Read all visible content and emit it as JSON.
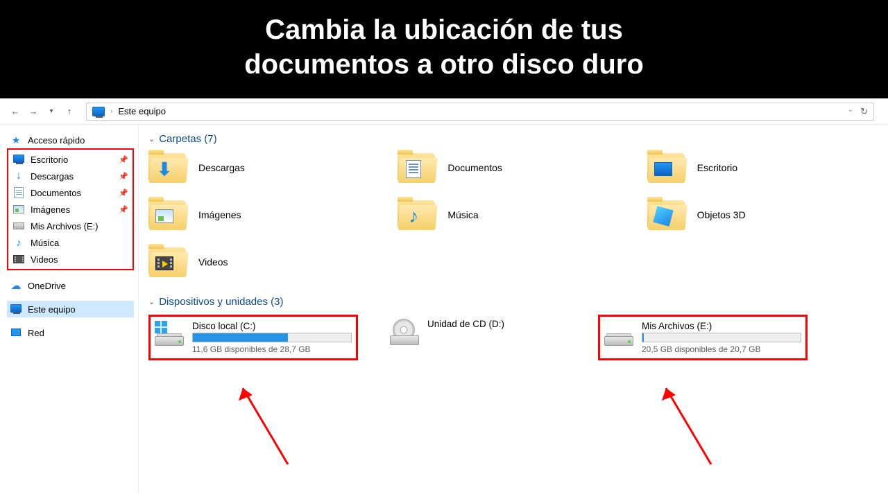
{
  "banner": {
    "line1": "Cambia la ubicación de tus",
    "line2": "documentos a otro disco duro"
  },
  "addressbar": {
    "location": "Este equipo"
  },
  "sidebar": {
    "quick_access": "Acceso rápido",
    "quick_items": [
      {
        "label": "Escritorio",
        "icon": "desktop",
        "pinned": true
      },
      {
        "label": "Descargas",
        "icon": "download",
        "pinned": true
      },
      {
        "label": "Documentos",
        "icon": "document",
        "pinned": true
      },
      {
        "label": "Imágenes",
        "icon": "image",
        "pinned": true
      },
      {
        "label": "Mis Archivos (E:)",
        "icon": "drive",
        "pinned": false
      },
      {
        "label": "Música",
        "icon": "music",
        "pinned": false
      },
      {
        "label": "Videos",
        "icon": "video",
        "pinned": false
      }
    ],
    "onedrive": "OneDrive",
    "thispc": "Este equipo",
    "network": "Red"
  },
  "sections": {
    "folders_header": "Carpetas (7)",
    "devices_header": "Dispositivos y unidades (3)"
  },
  "folders": [
    {
      "label": "Descargas",
      "overlay": "download"
    },
    {
      "label": "Documentos",
      "overlay": "document"
    },
    {
      "label": "Escritorio",
      "overlay": "desktop"
    },
    {
      "label": "Imágenes",
      "overlay": "image"
    },
    {
      "label": "Música",
      "overlay": "music"
    },
    {
      "label": "Objetos 3D",
      "overlay": "cube3d"
    },
    {
      "label": "Videos",
      "overlay": "video"
    }
  ],
  "devices": [
    {
      "name": "Disco local (C:)",
      "sub": "11,6 GB disponibles de 28,7 GB",
      "type": "hdd-win",
      "fill_pct": 60,
      "highlight": true
    },
    {
      "name": "Unidad de CD (D:)",
      "sub": "",
      "type": "cd",
      "fill_pct": null,
      "highlight": false
    },
    {
      "name": "Mis Archivos (E:)",
      "sub": "20,5 GB disponibles de 20,7 GB",
      "type": "hdd",
      "fill_pct": 1,
      "highlight": true
    }
  ]
}
